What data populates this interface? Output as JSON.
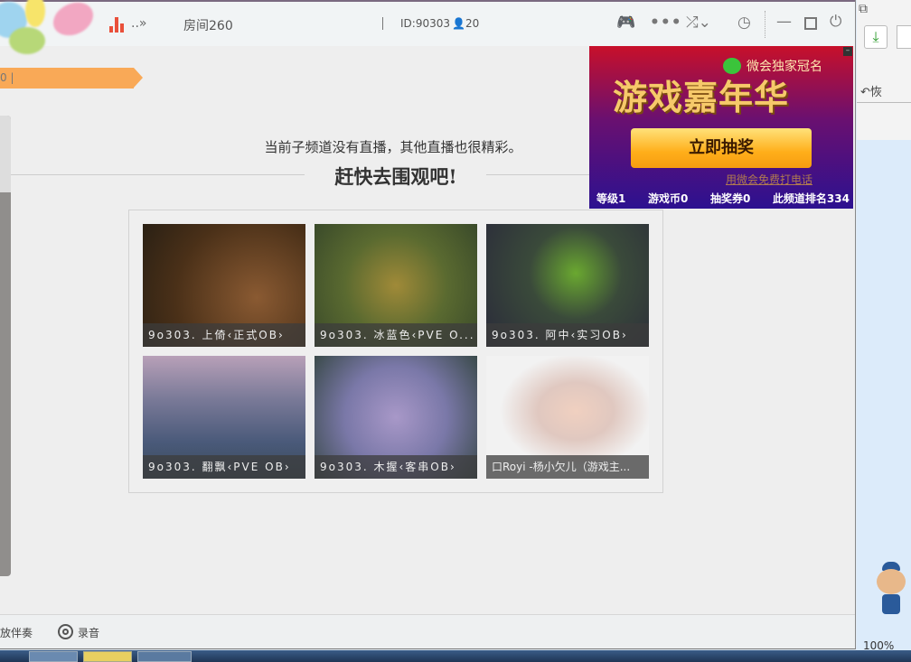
{
  "titlebar": {
    "more": "..»",
    "room": "房间260",
    "id": "ID:90303",
    "online": "20"
  },
  "banner": {
    "text": "0 |"
  },
  "notice": "当前子频道没有直播，其他直播也很精彩。",
  "heading": "赶快去围观吧!",
  "channels": [
    {
      "caption": "9o303. 上倚‹正式OB›"
    },
    {
      "caption": "9o303. 冰蓝色‹PVE O..."
    },
    {
      "caption": "9o303. 阿中‹实习OB›"
    },
    {
      "caption": "9o303. 翻飘‹PVE OB›"
    },
    {
      "caption": "9o303. 木握‹客串OB›"
    },
    {
      "caption": "口Royi  -杨小欠儿（游戏主..."
    }
  ],
  "ad": {
    "sponsor": "微会独家冠名",
    "title": "游戏嘉年华",
    "button": "立即抽奖",
    "link": "用微会免费打电话",
    "stats": [
      "等级1",
      "游戏币0",
      "抽奖券0",
      "此频道排名334"
    ]
  },
  "bottombar": {
    "accompany": "放伴奏",
    "record": "录音"
  },
  "browser": {
    "restore": "恢",
    "zoom": "100%"
  }
}
